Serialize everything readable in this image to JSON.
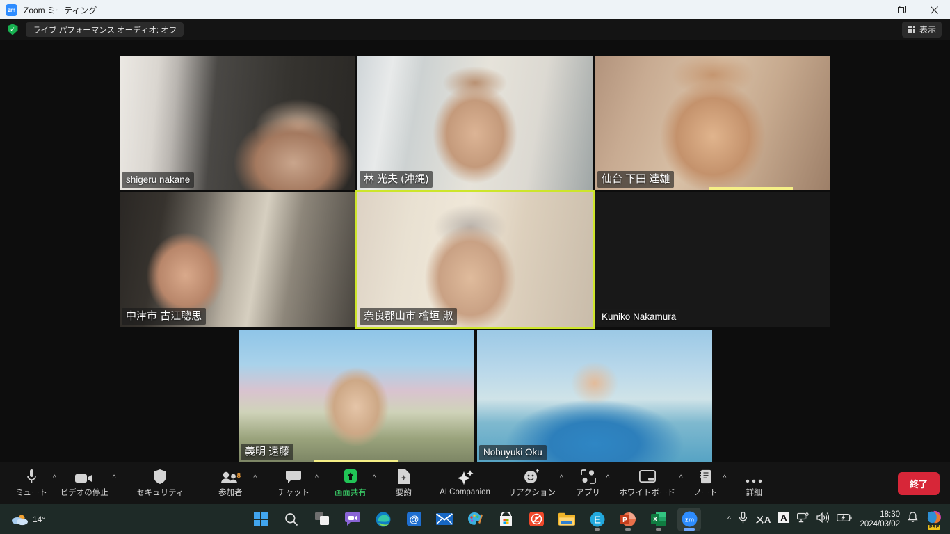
{
  "window": {
    "app_icon": "zoom-logo-icon",
    "title": "Zoom ミーティング",
    "minimize": "—",
    "maximize": "❐",
    "close": "✕"
  },
  "header": {
    "encryption_icon": "shield-check-icon",
    "status_text": "ライブ パフォーマンス オーディオ: オフ",
    "view_icon": "grid-view-icon",
    "view_label": "表示"
  },
  "gallery": {
    "active_border_color": "#cde52b",
    "audio_bar_color": "#f5ef86",
    "participants": [
      {
        "name": "shigeru nakane",
        "jp": false,
        "active": false,
        "speaking": false
      },
      {
        "name": "林 光夫 (沖縄)",
        "jp": true,
        "active": false,
        "speaking": false
      },
      {
        "name": "仙台 下田 達雄",
        "jp": true,
        "active": false,
        "speaking": true
      },
      {
        "name": "中津市 古江聰思",
        "jp": true,
        "active": false,
        "speaking": false
      },
      {
        "name": "奈良郡山市 檜垣 淑",
        "jp": true,
        "active": true,
        "speaking": true
      },
      {
        "name": "Kuniko Nakamura",
        "jp": false,
        "active": false,
        "speaking": false
      },
      {
        "name": "義明 遠藤",
        "jp": true,
        "active": false,
        "speaking": true
      },
      {
        "name": "Nobuyuki Oku",
        "jp": false,
        "active": false,
        "speaking": false
      }
    ]
  },
  "toolbar": {
    "items": [
      {
        "icon": "microphone-icon",
        "label": "ミュート",
        "caret": true,
        "badge": "",
        "highlight": false
      },
      {
        "icon": "video-camera-icon",
        "label": "ビデオの停止",
        "caret": true,
        "badge": "",
        "highlight": false
      },
      {
        "icon": "shield-icon",
        "label": "セキュリティ",
        "caret": false,
        "badge": "",
        "highlight": false
      },
      {
        "icon": "participants-icon",
        "label": "参加者",
        "caret": true,
        "badge": "8",
        "highlight": false
      },
      {
        "icon": "chat-bubble-icon",
        "label": "チャット",
        "caret": true,
        "badge": "",
        "highlight": false
      },
      {
        "icon": "share-screen-icon",
        "label": "画面共有",
        "caret": true,
        "badge": "",
        "highlight": true
      },
      {
        "icon": "summary-doc-icon",
        "label": "要約",
        "caret": false,
        "badge": "",
        "highlight": false
      },
      {
        "icon": "ai-sparkle-icon",
        "label": "AI Companion",
        "caret": false,
        "badge": "",
        "highlight": false
      },
      {
        "icon": "reactions-smiley-icon",
        "label": "リアクション",
        "caret": true,
        "badge": "",
        "highlight": false
      },
      {
        "icon": "apps-icon",
        "label": "アプリ",
        "caret": true,
        "badge": "",
        "highlight": false
      },
      {
        "icon": "whiteboard-icon",
        "label": "ホワイトボード",
        "caret": true,
        "badge": "",
        "highlight": false
      },
      {
        "icon": "notes-icon",
        "label": "ノート",
        "caret": true,
        "badge": "",
        "highlight": false
      },
      {
        "icon": "more-ellipsis-icon",
        "label": "詳細",
        "caret": false,
        "badge": "",
        "highlight": false
      }
    ],
    "end_label": "終了",
    "end_color": "#d72638"
  },
  "taskbar": {
    "weather": {
      "icon": "cloud-icon",
      "temperature": "14°"
    },
    "apps": [
      {
        "icon": "windows-start-icon",
        "label": "スタート",
        "active": false,
        "running": false
      },
      {
        "icon": "search-icon",
        "label": "検索",
        "active": false,
        "running": false
      },
      {
        "icon": "task-view-icon",
        "label": "タスク ビュー",
        "active": false,
        "running": false
      },
      {
        "icon": "teams-chat-icon",
        "label": "チャット",
        "active": false,
        "running": false
      },
      {
        "icon": "edge-browser-icon",
        "label": "Microsoft Edge",
        "active": false,
        "running": false
      },
      {
        "icon": "mail-at-icon",
        "label": "メール",
        "active": false,
        "running": false
      },
      {
        "icon": "mail-envelope-icon",
        "label": "メール",
        "active": false,
        "running": false
      },
      {
        "icon": "paint-icon",
        "label": "ペイント",
        "active": false,
        "running": false
      },
      {
        "icon": "microsoft-store-icon",
        "label": "Microsoft Store",
        "active": false,
        "running": false
      },
      {
        "icon": "antivirus-icon",
        "label": "セキュリティ",
        "active": false,
        "running": false
      },
      {
        "icon": "file-explorer-icon",
        "label": "エクスプローラー",
        "active": false,
        "running": false
      },
      {
        "icon": "edge-e-icon",
        "label": "E",
        "active": false,
        "running": true
      },
      {
        "icon": "powerpoint-icon",
        "label": "PowerPoint",
        "active": false,
        "running": true
      },
      {
        "icon": "excel-icon",
        "label": "Excel",
        "active": false,
        "running": true
      },
      {
        "icon": "zoom-app-icon",
        "label": "Zoom",
        "active": true,
        "running": true
      }
    ],
    "tray": {
      "overflow_icon": "chevron-up-icon",
      "mic_icon": "microphone-icon",
      "ime_icon": "ime-kana-icon",
      "ime_mode_icon": "ime-a-icon",
      "network_icon": "network-monitor-icon",
      "volume_icon": "speaker-icon",
      "battery_icon": "battery-charging-icon",
      "time": "18:30",
      "date": "2024/03/02",
      "notification_icon": "bell-icon",
      "copilot_icon": "copilot-icon",
      "copilot_badge": "PRE"
    }
  }
}
